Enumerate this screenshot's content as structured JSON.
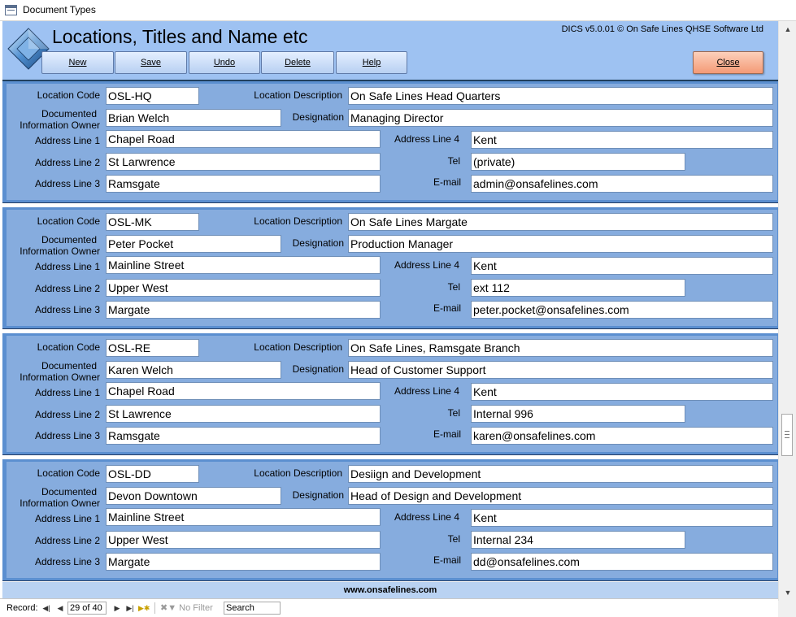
{
  "window": {
    "title": "Document Types"
  },
  "header": {
    "title": "Locations, Titles and Name etc",
    "version": "DICS v5.0.01 © On Safe Lines QHSE Software Ltd"
  },
  "toolbar": {
    "new_label": "New",
    "save_label": "Save",
    "undo_label": "Undo",
    "delete_label": "Delete",
    "help_label": "Help",
    "close_label": "Close"
  },
  "labels": {
    "location_code": "Location Code",
    "owner_line1": "Documented",
    "owner_line2": "Information Owner",
    "address1": "Address Line 1",
    "address2": "Address Line 2",
    "address3": "Address Line 3",
    "location_description": "Location Description",
    "designation": "Designation",
    "address4": "Address Line 4",
    "tel": "Tel",
    "email": "E-mail"
  },
  "records": [
    {
      "code": "OSL-HQ",
      "description": "On Safe Lines Head Quarters",
      "owner": "Brian Welch",
      "designation": "Managing Director",
      "address1": "Chapel Road",
      "address2": "St Larwrence",
      "address3": "Ramsgate",
      "address4": "Kent",
      "tel": "(private)",
      "email": "admin@onsafelines.com"
    },
    {
      "code": "OSL-MK",
      "description": "On Safe Lines Margate",
      "owner": "Peter Pocket",
      "designation": "Production Manager",
      "address1": "Mainline Street",
      "address2": "Upper West",
      "address3": "Margate",
      "address4": "Kent",
      "tel": "ext 112",
      "email": "peter.pocket@onsafelines.com"
    },
    {
      "code": "OSL-RE",
      "description": "On Safe Lines, Ramsgate Branch",
      "owner": "Karen Welch",
      "designation": "Head of Customer Support",
      "address1": "Chapel Road",
      "address2": "St Lawrence",
      "address3": "Ramsgate",
      "address4": "Kent",
      "tel": "Internal 996",
      "email": "karen@onsafelines.com"
    },
    {
      "code": "OSL-DD",
      "description": "Desiign and Development",
      "owner": "Devon Downtown",
      "designation": "Head of Design and Development",
      "address1": "Mainline Street",
      "address2": "Upper West",
      "address3": "Margate",
      "address4": "Kent",
      "tel": "Internal 234",
      "email": "dd@onsafelines.com"
    }
  ],
  "footer": {
    "url": "www.onsafelines.com"
  },
  "statusbar": {
    "record_label": "Record:",
    "record_position": "29 of 40",
    "filter_label": "No Filter",
    "search_label": "Search"
  },
  "colors": {
    "header_bg": "#9ec2f2",
    "record_bg": "#86acde",
    "record_border": "#5b8fd0",
    "close_button": "#f49a76"
  },
  "icons": {
    "app": "form-window-icon",
    "logo": "diamond-logo-icon",
    "filter": "filter-off-icon"
  }
}
